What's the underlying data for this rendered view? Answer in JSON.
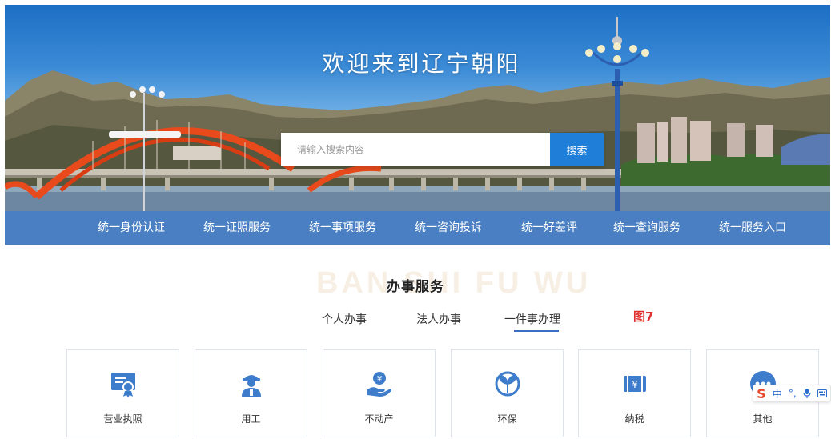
{
  "banner": {
    "title": "欢迎来到辽宁朝阳",
    "search_placeholder": "请输入搜索内容",
    "search_button": "搜索"
  },
  "nav": {
    "items": [
      {
        "label": "统一身份认证"
      },
      {
        "label": "统一证照服务"
      },
      {
        "label": "统一事项服务"
      },
      {
        "label": "统一咨询投诉"
      },
      {
        "label": "统一好差评"
      },
      {
        "label": "统一查询服务"
      },
      {
        "label": "统一服务入口"
      }
    ],
    "background_color": "#4a80c3"
  },
  "section": {
    "title": "办事服务",
    "background_text": "BAN SHI FU WU",
    "tabs": [
      {
        "label": "个人办事",
        "active": false
      },
      {
        "label": "法人办事",
        "active": false
      },
      {
        "label": "一件事办理",
        "active": true
      }
    ],
    "note": "图7"
  },
  "cards": [
    {
      "label": "营业执照",
      "icon": "business-license-icon"
    },
    {
      "label": "用工",
      "icon": "worker-icon"
    },
    {
      "label": "不动产",
      "icon": "real-estate-icon"
    },
    {
      "label": "环保",
      "icon": "environment-icon"
    },
    {
      "label": "纳税",
      "icon": "tax-icon"
    },
    {
      "label": "其他",
      "icon": "more-icon"
    }
  ],
  "ime_toolbar": {
    "logo": "S",
    "mode": "中",
    "punct": "°,"
  },
  "colors": {
    "accent": "#1f7ed8",
    "icon": "#3e7ccc",
    "note": "#e03030"
  }
}
